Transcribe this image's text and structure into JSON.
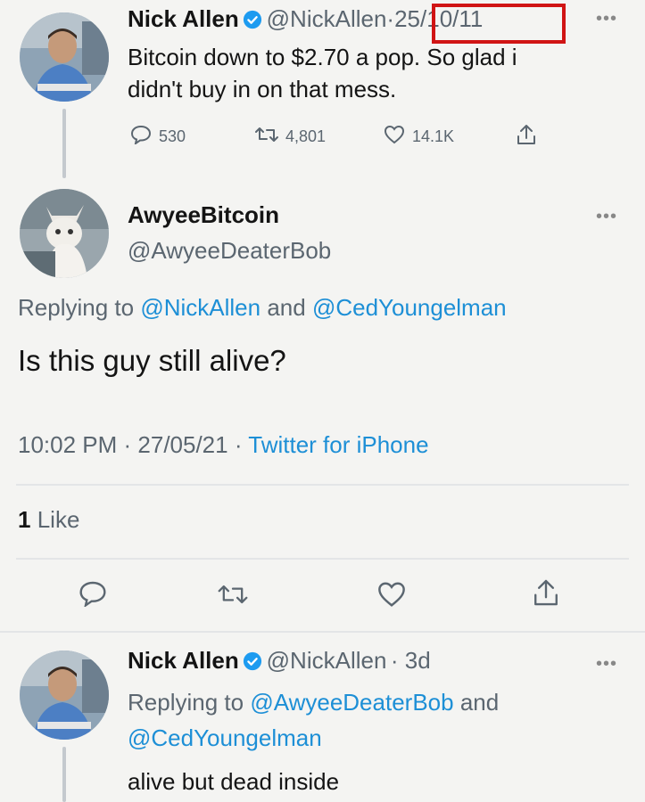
{
  "tweet1": {
    "name": "Nick Allen",
    "handle": "@NickAllen",
    "sep": "·",
    "date": "25/10/11",
    "text_line1": "Bitcoin down to $2.70 a pop. So glad i",
    "text_line2": "didn't buy in on that mess.",
    "replies": "530",
    "retweets": "4,801",
    "likes": "14.1K"
  },
  "reply": {
    "name": "AwyeeBitcoin",
    "handle": "@AwyeeDeaterBob",
    "replying_prefix": "Replying to",
    "replying_user1": "@NickAllen",
    "replying_and": "and",
    "replying_user2": "@CedYoungelman",
    "text": "Is this guy still alive?",
    "time": "10:02 PM · 27/05/21 ·",
    "client": "Twitter for iPhone",
    "likes_count": "1",
    "likes_label": "Like"
  },
  "tweet3": {
    "name": "Nick Allen",
    "handle": "@NickAllen",
    "age": "· 3d",
    "replying_prefix": "Replying to",
    "replying_user1": "@AwyeeDeaterBob",
    "replying_and": "and",
    "replying_user2": "@CedYoungelman",
    "text": "alive but dead inside"
  },
  "colors": {
    "link": "#1d8fd6",
    "highlight_box": "#d01414",
    "verified": "#1d9bf0"
  }
}
